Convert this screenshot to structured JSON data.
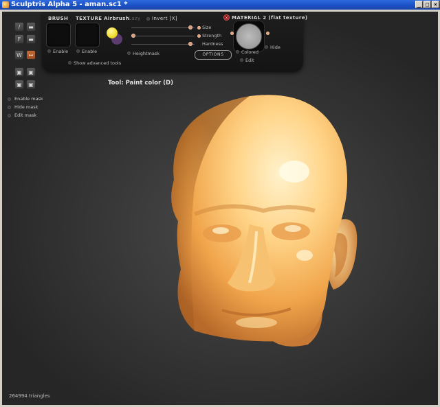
{
  "window": {
    "title": "Sculptris Alpha 5 - aman.sc1 *",
    "buttons": [
      "_",
      "□",
      "×"
    ]
  },
  "toolbar": {
    "brush_label": "BRUSH",
    "texture_label": "TEXTURE",
    "airbrush_label": "Airbrush",
    "lazy_label": "Lazy",
    "invert_label": "Invert [X]",
    "brush_enable": "Enable",
    "texture_enable": "Enable",
    "show_advanced": "Show advanced tools",
    "heightmask": "Heightmask",
    "size_label": "Size",
    "strength_label": "Strength",
    "hardness_label": "Hardness",
    "options_label": "OPTIONS",
    "size_value": 0.93,
    "strength_value": 0.03,
    "hardness_value": 0.93,
    "paint_color": "#f0dc2a"
  },
  "material": {
    "title": "MATERIAL 2 (flat texture)",
    "colored_label": "Colored",
    "edit_label": "Edit",
    "hide_label": "Hide"
  },
  "tools": [
    {
      "name": "draw-tool",
      "glyph": "/"
    },
    {
      "name": "flatten-tool",
      "glyph": "▬"
    },
    {
      "name": "fill-tool",
      "glyph": "F"
    },
    {
      "name": "crease-tool",
      "glyph": "▬"
    },
    {
      "name": "symmetry-tool",
      "glyph": "W"
    },
    {
      "name": "grab-tool",
      "glyph": "↔",
      "active": true
    },
    {
      "name": "brush-tool-1",
      "glyph": "▣"
    },
    {
      "name": "brush-tool-2",
      "glyph": "▣"
    },
    {
      "name": "brush-tool-3",
      "glyph": "▣"
    },
    {
      "name": "brush-tool-4",
      "glyph": "▣"
    }
  ],
  "mask": {
    "enable": "Enable mask",
    "hide": "Hide mask",
    "edit": "Edit mask"
  },
  "status": {
    "tool": "Tool: Paint color (D)",
    "triangles": "264994 triangles"
  },
  "colors": {
    "skin_light": "#ffe7b0",
    "skin_mid": "#f7b860",
    "skin_dark": "#b8692a",
    "accent_knob": "#d99a7a"
  }
}
